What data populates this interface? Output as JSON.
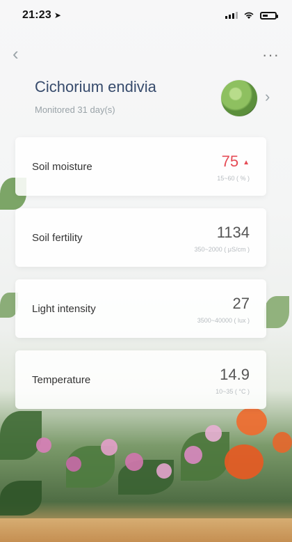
{
  "status_bar": {
    "time": "21:23"
  },
  "nav": {
    "back": "‹",
    "more": "···"
  },
  "plant": {
    "name": "Cichorium endivia",
    "monitored": "Monitored 31 day(s)"
  },
  "metrics": [
    {
      "label": "Soil moisture",
      "value": "75",
      "range": "15~60 ( % )",
      "alert": true
    },
    {
      "label": "Soil fertility",
      "value": "1134",
      "range": "350~2000 ( μS/cm )",
      "alert": false
    },
    {
      "label": "Light intensity",
      "value": "27",
      "range": "3500~40000 ( lux )",
      "alert": false
    },
    {
      "label": "Temperature",
      "value": "14.9",
      "range": "10~35 ( °C )",
      "alert": false
    }
  ],
  "colors": {
    "alert": "#e54b55",
    "title": "#374b6c",
    "muted": "#9aa3a8"
  }
}
